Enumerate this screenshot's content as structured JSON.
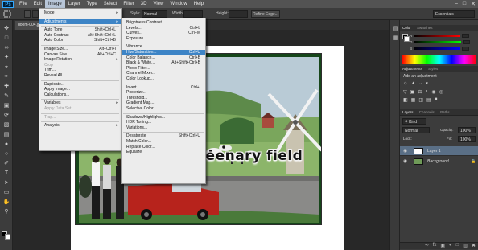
{
  "menubar": {
    "logo": "Ps",
    "items": [
      "File",
      "Edit",
      "Image",
      "Layer",
      "Type",
      "Select",
      "Filter",
      "3D",
      "View",
      "Window",
      "Help"
    ],
    "active_index": 2,
    "window_controls": [
      "–",
      "□",
      "✕"
    ]
  },
  "options_bar": {
    "style_label": "Style:",
    "style_value": "Normal",
    "width_label": "Width:",
    "height_label": "Height:",
    "refine_edge": "Refine Edge...",
    "workspace": "Essentials"
  },
  "document": {
    "tab_label": "doom-004.jp",
    "title_text": "greenary field"
  },
  "image_menu": {
    "items": [
      {
        "label": "Mode",
        "submenu": true
      },
      {
        "sep": true
      },
      {
        "label": "Adjustments",
        "submenu": true,
        "highlight": true
      },
      {
        "sep": true
      },
      {
        "label": "Auto Tone",
        "shortcut": "Shift+Ctrl+L"
      },
      {
        "label": "Auto Contrast",
        "shortcut": "Alt+Shift+Ctrl+L"
      },
      {
        "label": "Auto Color",
        "shortcut": "Shift+Ctrl+B"
      },
      {
        "sep": true
      },
      {
        "label": "Image Size...",
        "shortcut": "Alt+Ctrl+I"
      },
      {
        "label": "Canvas Size...",
        "shortcut": "Alt+Ctrl+C"
      },
      {
        "label": "Image Rotation",
        "submenu": true
      },
      {
        "label": "Crop",
        "disabled": true
      },
      {
        "label": "Trim..."
      },
      {
        "label": "Reveal All"
      },
      {
        "sep": true
      },
      {
        "label": "Duplicate..."
      },
      {
        "label": "Apply Image..."
      },
      {
        "label": "Calculations..."
      },
      {
        "sep": true
      },
      {
        "label": "Variables",
        "submenu": true
      },
      {
        "label": "Apply Data Set...",
        "disabled": true
      },
      {
        "sep": true
      },
      {
        "label": "Trap...",
        "disabled": true
      },
      {
        "sep": true
      },
      {
        "label": "Analysis",
        "submenu": true
      }
    ]
  },
  "adjust_menu": {
    "items": [
      {
        "label": "Brightness/Contrast..."
      },
      {
        "label": "Levels...",
        "shortcut": "Ctrl+L"
      },
      {
        "label": "Curves...",
        "shortcut": "Ctrl+M"
      },
      {
        "label": "Exposure..."
      },
      {
        "sep": true
      },
      {
        "label": "Vibrance..."
      },
      {
        "label": "Hue/Saturation...",
        "shortcut": "Ctrl+U",
        "highlight": true
      },
      {
        "label": "Color Balance...",
        "shortcut": "Ctrl+B"
      },
      {
        "label": "Black & White...",
        "shortcut": "Alt+Shift+Ctrl+B"
      },
      {
        "label": "Photo Filter..."
      },
      {
        "label": "Channel Mixer..."
      },
      {
        "label": "Color Lookup..."
      },
      {
        "sep": true
      },
      {
        "label": "Invert",
        "shortcut": "Ctrl+I"
      },
      {
        "label": "Posterize..."
      },
      {
        "label": "Threshold..."
      },
      {
        "label": "Gradient Map..."
      },
      {
        "label": "Selective Color..."
      },
      {
        "sep": true
      },
      {
        "label": "Shadows/Highlights..."
      },
      {
        "label": "HDR Toning..."
      },
      {
        "label": "Variations..."
      },
      {
        "sep": true
      },
      {
        "label": "Desaturate",
        "shortcut": "Shift+Ctrl+U"
      },
      {
        "label": "Match Color..."
      },
      {
        "label": "Replace Color..."
      },
      {
        "label": "Equalize"
      }
    ]
  },
  "color_panel": {
    "tabs": [
      "Color",
      "Swatches"
    ],
    "channels": [
      "R",
      "G",
      "B"
    ]
  },
  "adjustments_panel": {
    "tabs": [
      "Adjustments",
      "Styles"
    ],
    "hint": "Add an adjustment"
  },
  "layers_panel": {
    "tabs": [
      "Layers",
      "Channels",
      "Paths"
    ],
    "kind_label": "Kind",
    "blend_mode": "Normal",
    "opacity_label": "Opacity:",
    "opacity_value": "100%",
    "lock_label": "Lock:",
    "fill_label": "Fill:",
    "fill_value": "100%",
    "layers": [
      {
        "name": "Layer 1",
        "selected": true
      },
      {
        "name": "Background",
        "selected": false
      }
    ]
  },
  "colors": {
    "menu_highlight": "#3d84c6",
    "layer_selected": "#5a6f86",
    "ui_dark": "#3c3c3c"
  }
}
